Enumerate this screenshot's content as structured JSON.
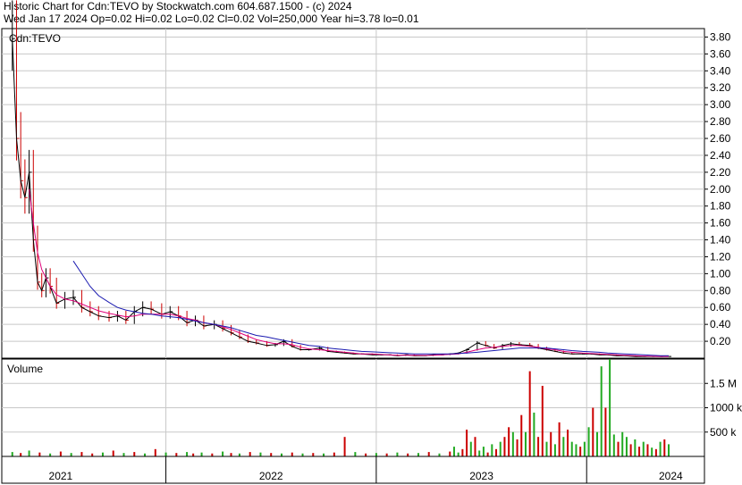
{
  "header": {
    "line1": "Historic Chart for Cdn:TEVO by Stockwatch.com 604.687.1500 - (c) 2024",
    "line2": "Wed Jan 17 2024   Op=0.02  Hi=0.02  Lo=0.02  Cl=0.02  Vol=250,000  Year hi=3.78  lo=0.01"
  },
  "chart_data": [
    {
      "type": "line",
      "title": "Cdn:TEVO",
      "ylim": [
        0,
        3.9
      ],
      "y_ticks": [
        "3.80",
        "3.60",
        "3.40",
        "3.20",
        "3.00",
        "2.80",
        "2.60",
        "2.40",
        "2.20",
        "2.00",
        "1.80",
        "1.60",
        "1.40",
        "1.20",
        "1.00",
        "0.80",
        "0.60",
        "0.40",
        "0.20"
      ],
      "x_ticks": [
        "2021",
        "2022",
        "2023",
        "2024"
      ],
      "colors": {
        "price_up": "#000000",
        "price_down": "#cc0000",
        "ma_short": "#e0007a",
        "ma_long": "#1a1ab0",
        "grid": "#c8c8c8"
      },
      "x": [
        2020.92,
        2020.94,
        2020.96,
        2020.98,
        2021.0,
        2021.02,
        2021.04,
        2021.06,
        2021.08,
        2021.1,
        2021.13,
        2021.17,
        2021.21,
        2021.25,
        2021.29,
        2021.33,
        2021.38,
        2021.42,
        2021.46,
        2021.5,
        2021.54,
        2021.58,
        2021.63,
        2021.67,
        2021.71,
        2021.75,
        2021.79,
        2021.83,
        2021.88,
        2021.92,
        2021.96,
        2022.0,
        2022.04,
        2022.08,
        2022.13,
        2022.17,
        2022.21,
        2022.25,
        2022.29,
        2022.33,
        2022.38,
        2022.42,
        2022.46,
        2022.5,
        2022.54,
        2022.58,
        2022.63,
        2022.67,
        2022.71,
        2022.75,
        2022.79,
        2022.83,
        2022.88,
        2022.92,
        2022.96,
        2023.0,
        2023.04,
        2023.08,
        2023.13,
        2023.17,
        2023.21,
        2023.25,
        2023.29,
        2023.33,
        2023.38,
        2023.42,
        2023.46,
        2023.5,
        2023.54,
        2023.58,
        2023.63,
        2023.67,
        2023.71,
        2023.75,
        2023.79,
        2023.83,
        2023.88,
        2023.92,
        2023.96,
        2024.0,
        2024.04
      ],
      "series": [
        {
          "values": [
            3.78,
            2.6,
            2.1,
            1.9,
            2.2,
            1.4,
            0.9,
            0.8,
            0.95,
            0.85,
            0.65,
            0.7,
            0.72,
            0.6,
            0.55,
            0.5,
            0.48,
            0.5,
            0.45,
            0.55,
            0.6,
            0.58,
            0.52,
            0.55,
            0.5,
            0.42,
            0.45,
            0.38,
            0.4,
            0.35,
            0.3,
            0.25,
            0.2,
            0.18,
            0.15,
            0.16,
            0.2,
            0.14,
            0.1,
            0.1,
            0.12,
            0.08,
            0.07,
            0.06,
            0.05,
            0.05,
            0.04,
            0.04,
            0.04,
            0.03,
            0.04,
            0.03,
            0.03,
            0.04,
            0.04,
            0.05,
            0.06,
            0.1,
            0.18,
            0.15,
            0.12,
            0.15,
            0.17,
            0.16,
            0.15,
            0.12,
            0.1,
            0.08,
            0.06,
            0.05,
            0.05,
            0.05,
            0.04,
            0.04,
            0.03,
            0.03,
            0.02,
            0.02,
            0.02,
            0.02,
            0.02
          ]
        },
        {
          "values": [
            null,
            null,
            null,
            null,
            2.0,
            1.6,
            1.25,
            1.05,
            0.95,
            0.85,
            0.75,
            0.7,
            0.68,
            0.64,
            0.6,
            0.56,
            0.53,
            0.51,
            0.49,
            0.5,
            0.52,
            0.52,
            0.52,
            0.52,
            0.5,
            0.47,
            0.45,
            0.42,
            0.4,
            0.37,
            0.34,
            0.3,
            0.26,
            0.22,
            0.19,
            0.17,
            0.17,
            0.16,
            0.13,
            0.11,
            0.1,
            0.09,
            0.08,
            0.07,
            0.06,
            0.05,
            0.05,
            0.045,
            0.04,
            0.035,
            0.035,
            0.035,
            0.033,
            0.035,
            0.04,
            0.045,
            0.05,
            0.07,
            0.1,
            0.12,
            0.13,
            0.14,
            0.15,
            0.15,
            0.14,
            0.13,
            0.11,
            0.1,
            0.08,
            0.07,
            0.06,
            0.055,
            0.05,
            0.045,
            0.04,
            0.035,
            0.03,
            0.025,
            0.022,
            0.02,
            0.02
          ]
        },
        {
          "values": [
            null,
            null,
            null,
            null,
            null,
            null,
            null,
            null,
            null,
            null,
            null,
            null,
            1.15,
            1.0,
            0.85,
            0.74,
            0.66,
            0.6,
            0.57,
            0.55,
            0.53,
            0.52,
            0.5,
            0.49,
            0.48,
            0.46,
            0.44,
            0.42,
            0.4,
            0.38,
            0.36,
            0.33,
            0.3,
            0.27,
            0.25,
            0.23,
            0.21,
            0.19,
            0.17,
            0.15,
            0.14,
            0.12,
            0.11,
            0.1,
            0.09,
            0.08,
            0.075,
            0.07,
            0.065,
            0.06,
            0.055,
            0.05,
            0.05,
            0.05,
            0.05,
            0.05,
            0.055,
            0.06,
            0.07,
            0.08,
            0.09,
            0.1,
            0.11,
            0.12,
            0.12,
            0.12,
            0.12,
            0.11,
            0.1,
            0.09,
            0.08,
            0.075,
            0.07,
            0.06,
            0.055,
            0.05,
            0.045,
            0.04,
            0.035,
            0.03,
            0.03
          ]
        }
      ]
    },
    {
      "type": "bar",
      "title": "Volume",
      "ylim": [
        0,
        2000000
      ],
      "y_ticks": [
        "1.5 M",
        "1000 k",
        "500 k"
      ],
      "x": [
        2020.92,
        2020.96,
        2021.0,
        2021.05,
        2021.1,
        2021.15,
        2021.2,
        2021.25,
        2021.3,
        2021.35,
        2021.4,
        2021.45,
        2021.5,
        2021.55,
        2021.6,
        2021.65,
        2021.7,
        2021.75,
        2021.78,
        2021.82,
        2021.87,
        2021.92,
        2021.96,
        2022.0,
        2022.05,
        2022.1,
        2022.15,
        2022.2,
        2022.25,
        2022.3,
        2022.35,
        2022.4,
        2022.45,
        2022.5,
        2022.55,
        2022.6,
        2022.65,
        2022.7,
        2022.75,
        2022.8,
        2022.85,
        2022.9,
        2022.95,
        2023.0,
        2023.02,
        2023.04,
        2023.06,
        2023.08,
        2023.1,
        2023.12,
        2023.14,
        2023.16,
        2023.18,
        2023.2,
        2023.22,
        2023.24,
        2023.26,
        2023.28,
        2023.3,
        2023.32,
        2023.34,
        2023.36,
        2023.38,
        2023.4,
        2023.42,
        2023.44,
        2023.46,
        2023.48,
        2023.5,
        2023.52,
        2023.54,
        2023.56,
        2023.58,
        2023.6,
        2023.62,
        2023.64,
        2023.66,
        2023.68,
        2023.7,
        2023.72,
        2023.74,
        2023.76,
        2023.78,
        2023.8,
        2023.82,
        2023.84,
        2023.86,
        2023.88,
        2023.9,
        2023.92,
        2023.94,
        2023.96,
        2023.98,
        2024.0,
        2024.02,
        2024.04
      ],
      "values": [
        90000,
        70000,
        120000,
        80000,
        60000,
        100000,
        70000,
        90000,
        60000,
        80000,
        120000,
        70000,
        90000,
        60000,
        150000,
        80000,
        70000,
        90000,
        60000,
        80000,
        60000,
        100000,
        70000,
        60000,
        90000,
        80000,
        70000,
        60000,
        80000,
        60000,
        70000,
        60000,
        80000,
        400000,
        90000,
        60000,
        70000,
        60000,
        80000,
        60000,
        70000,
        90000,
        60000,
        100000,
        200000,
        80000,
        150000,
        550000,
        300000,
        400000,
        120000,
        200000,
        80000,
        250000,
        150000,
        300000,
        400000,
        600000,
        500000,
        350000,
        850000,
        500000,
        1750000,
        900000,
        400000,
        1450000,
        300000,
        500000,
        250000,
        700000,
        400000,
        550000,
        300000,
        250000,
        200000,
        300000,
        600000,
        1000000,
        500000,
        1850000,
        1000000,
        2000000,
        450000,
        300000,
        500000,
        400000,
        250000,
        350000,
        200000,
        300000,
        250000,
        180000,
        150000,
        300000,
        350000,
        250000
      ],
      "up": [
        true,
        false,
        true,
        false,
        true,
        false,
        true,
        false,
        false,
        true,
        false,
        true,
        false,
        true,
        false,
        true,
        false,
        true,
        false,
        true,
        false,
        true,
        false,
        true,
        false,
        true,
        false,
        true,
        false,
        true,
        false,
        true,
        false,
        false,
        true,
        false,
        true,
        false,
        true,
        false,
        true,
        false,
        true,
        false,
        true,
        true,
        false,
        false,
        true,
        false,
        true,
        true,
        false,
        true,
        false,
        true,
        false,
        false,
        true,
        false,
        false,
        true,
        false,
        true,
        false,
        false,
        true,
        false,
        true,
        false,
        true,
        false,
        true,
        true,
        false,
        true,
        true,
        false,
        true,
        true,
        false,
        true,
        true,
        false,
        true,
        true,
        false,
        true,
        false,
        true,
        false,
        true,
        false,
        true,
        false,
        true
      ]
    }
  ]
}
